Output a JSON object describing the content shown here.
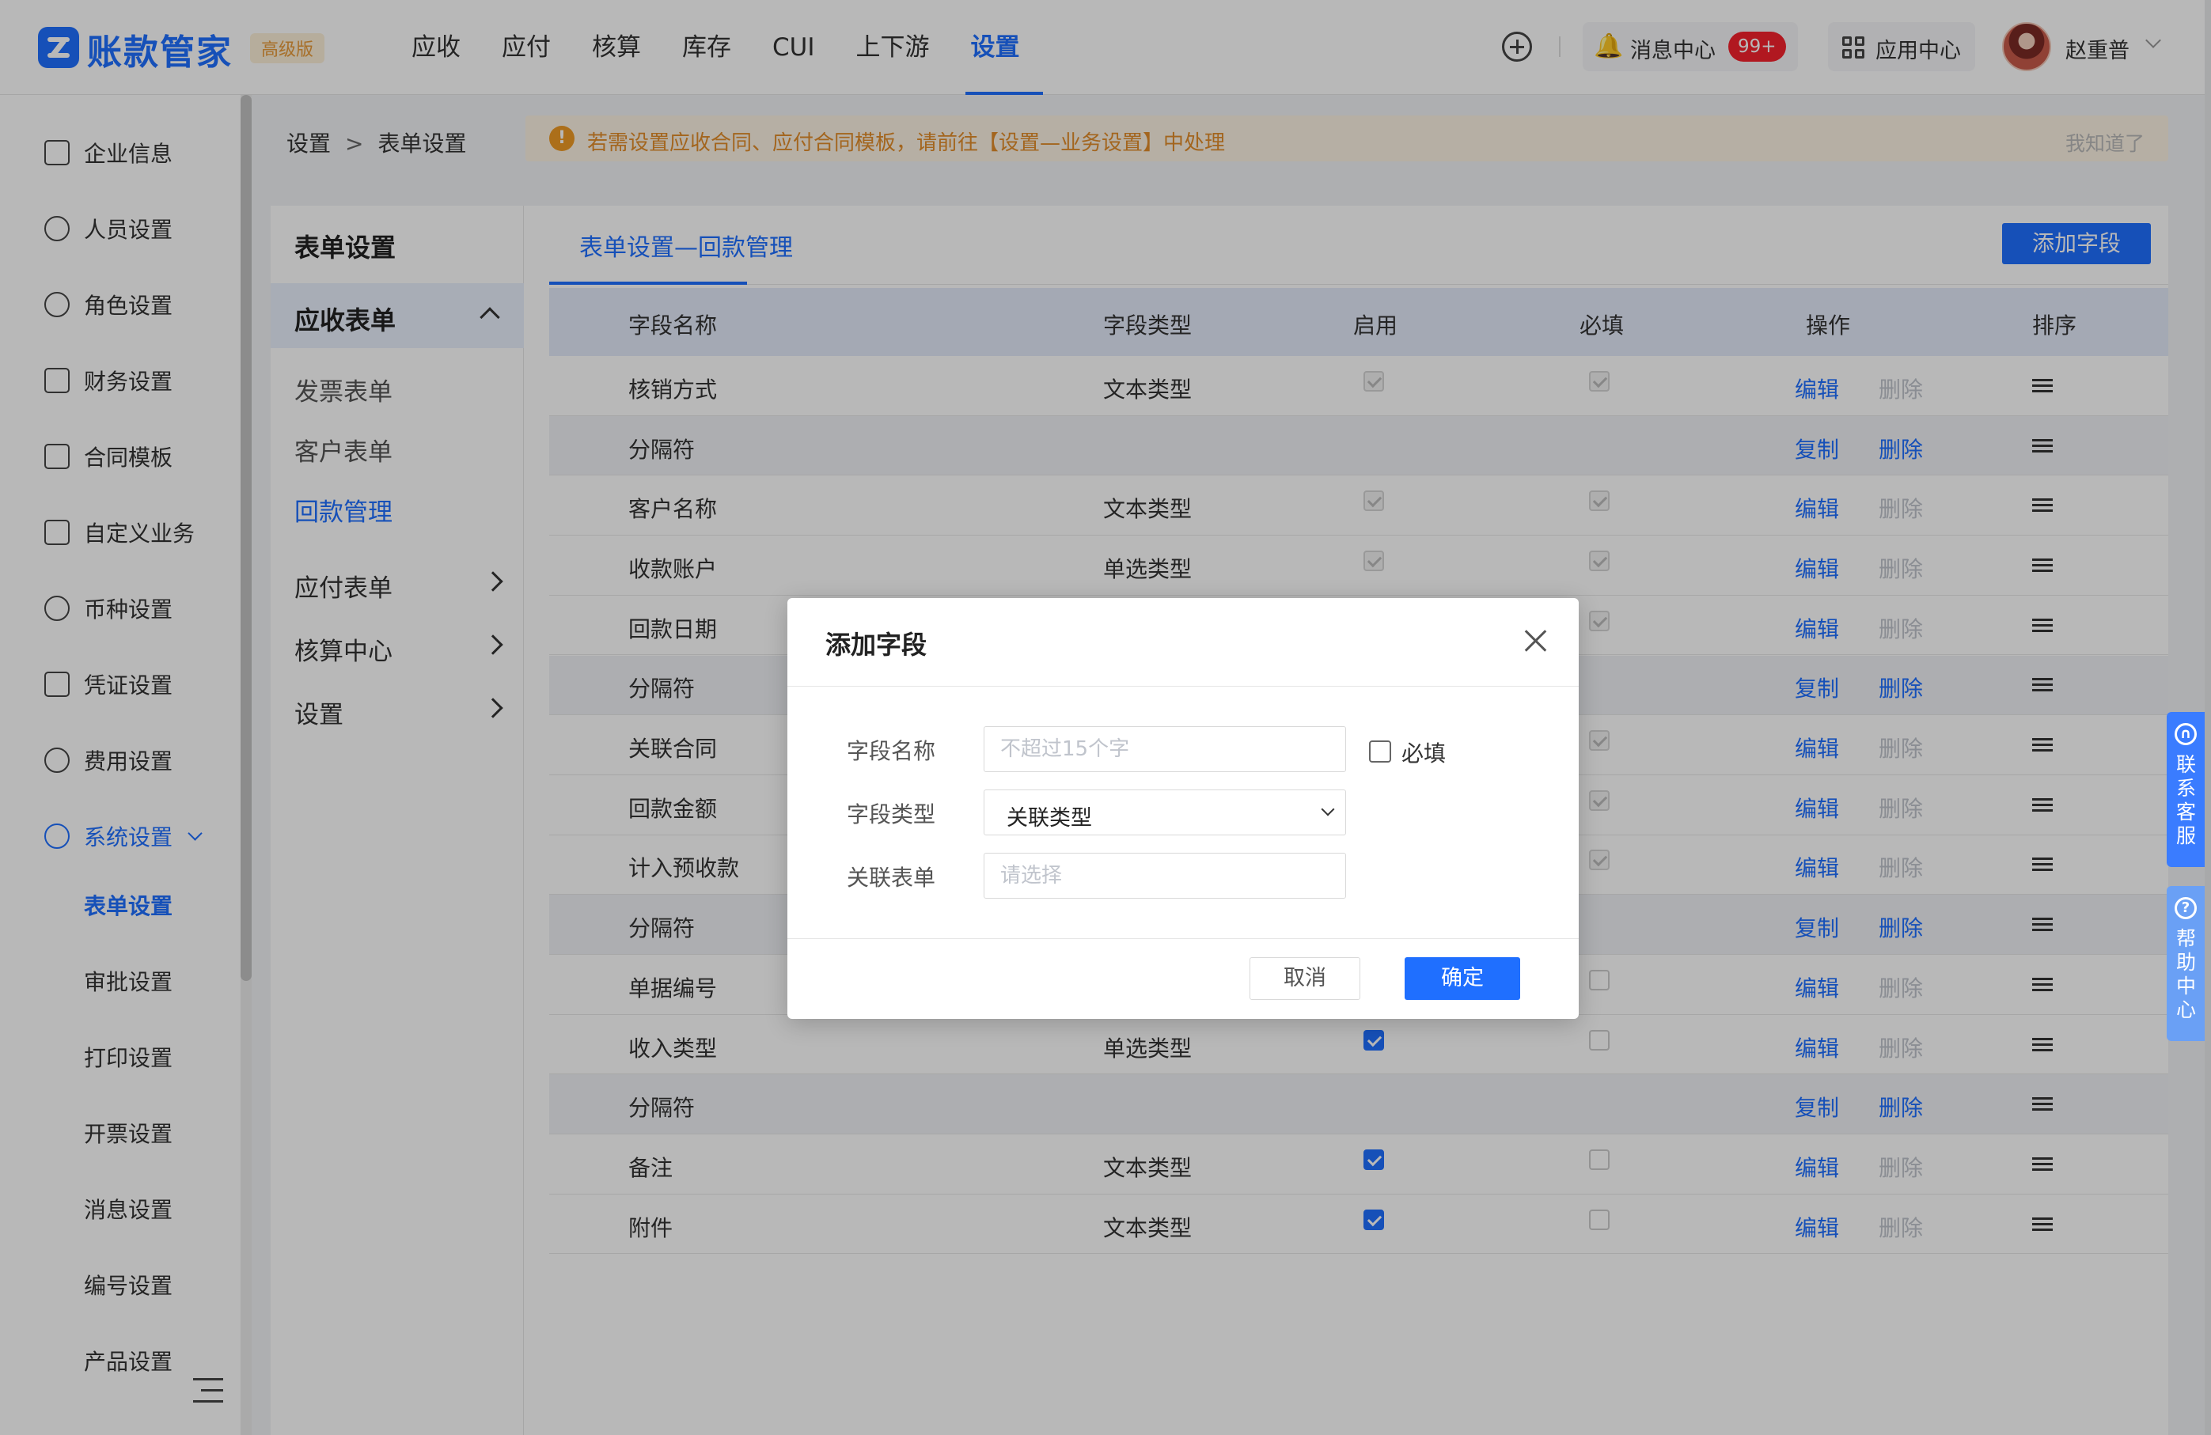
{
  "app": {
    "name": "账款管家",
    "edition": "高级版"
  },
  "nav": [
    "应收",
    "应付",
    "核算",
    "库存",
    "CUI",
    "上下游",
    "设置"
  ],
  "header": {
    "message_center": "消息中心",
    "message_count": "99+",
    "app_center": "应用中心",
    "user_name": "赵重普"
  },
  "sidebar": {
    "items": [
      {
        "label": "企业信息",
        "icon": "building-icon"
      },
      {
        "label": "人员设置",
        "icon": "user-icon"
      },
      {
        "label": "角色设置",
        "icon": "role-icon"
      },
      {
        "label": "财务设置",
        "icon": "finance-icon"
      },
      {
        "label": "合同模板",
        "icon": "contract-icon"
      },
      {
        "label": "自定义业务",
        "icon": "custom-business-icon"
      },
      {
        "label": "币种设置",
        "icon": "currency-icon"
      },
      {
        "label": "凭证设置",
        "icon": "voucher-icon"
      },
      {
        "label": "费用设置",
        "icon": "expense-icon"
      },
      {
        "label": "系统设置",
        "icon": "system-settings-icon"
      }
    ],
    "subitems": [
      "表单设置",
      "审批设置",
      "打印设置",
      "开票设置",
      "消息设置",
      "编号设置",
      "产品设置"
    ]
  },
  "breadcrumb": {
    "root": "设置",
    "separator": ">",
    "current": "表单设置"
  },
  "notice": {
    "text": "若需设置应收合同、应付合同模板，请前往【设置—业务设置】中处理",
    "dismiss": "我知道了"
  },
  "subnav": {
    "title": "表单设置",
    "group": "应收表单",
    "subitems": [
      "发票表单",
      "客户表单",
      "回款管理"
    ],
    "rows": [
      "应付表单",
      "核算中心",
      "设置"
    ]
  },
  "tab": {
    "title": "表单设置—回款管理",
    "add_button": "添加字段"
  },
  "table": {
    "headers": [
      "字段名称",
      "字段类型",
      "启用",
      "必填",
      "操作",
      "排序"
    ],
    "rows": [
      {
        "name": "核销方式",
        "type": "文本类型",
        "sep": false,
        "enabled": "disabled-checked",
        "required": "disabled-checked",
        "a1": "编辑",
        "a2": "删除"
      },
      {
        "name": "分隔符",
        "type": "",
        "sep": true,
        "a1": "复制",
        "a2": "删除"
      },
      {
        "name": "客户名称",
        "type": "文本类型",
        "sep": false,
        "enabled": "disabled-checked",
        "required": "disabled-checked",
        "a1": "编辑",
        "a2": "删除"
      },
      {
        "name": "收款账户",
        "type": "单选类型",
        "sep": false,
        "enabled": "disabled-checked",
        "required": "disabled-checked",
        "a1": "编辑",
        "a2": "删除"
      },
      {
        "name": "回款日期",
        "type": "",
        "sep": false,
        "enabled": "disabled-checked",
        "required": "disabled-checked",
        "a1": "编辑",
        "a2": "删除"
      },
      {
        "name": "分隔符",
        "type": "",
        "sep": true,
        "a1": "复制",
        "a2": "删除"
      },
      {
        "name": "关联合同",
        "type": "",
        "sep": false,
        "enabled": "disabled-checked",
        "required": "disabled-checked",
        "a1": "编辑",
        "a2": "删除"
      },
      {
        "name": "回款金额",
        "type": "",
        "sep": false,
        "enabled": "disabled-checked",
        "required": "disabled-checked",
        "a1": "编辑",
        "a2": "删除"
      },
      {
        "name": "计入预收款",
        "type": "",
        "sep": false,
        "enabled": "disabled-checked",
        "required": "disabled-checked",
        "a1": "编辑",
        "a2": "删除"
      },
      {
        "name": "分隔符",
        "type": "",
        "sep": true,
        "a1": "复制",
        "a2": "删除"
      },
      {
        "name": "单据编号",
        "type": "",
        "sep": false,
        "enabled": "checked",
        "required": "unchecked",
        "a1": "编辑",
        "a2": "删除"
      },
      {
        "name": "收入类型",
        "type": "单选类型",
        "sep": false,
        "enabled": "checked",
        "required": "unchecked",
        "a1": "编辑",
        "a2": "删除"
      },
      {
        "name": "分隔符",
        "type": "",
        "sep": true,
        "a1": "复制",
        "a2": "删除"
      },
      {
        "name": "备注",
        "type": "文本类型",
        "sep": false,
        "enabled": "checked",
        "required": "unchecked",
        "a1": "编辑",
        "a2": "删除"
      },
      {
        "name": "附件",
        "type": "文本类型",
        "sep": false,
        "enabled": "checked",
        "required": "unchecked",
        "a1": "编辑",
        "a2": "删除"
      }
    ]
  },
  "modal": {
    "title": "添加字段",
    "field_name_label": "字段名称",
    "field_name_placeholder": "不超过15个字",
    "required_label": "必填",
    "field_type_label": "字段类型",
    "field_type_value": "关联类型",
    "related_form_label": "关联表单",
    "related_form_placeholder": "请选择",
    "cancel": "取消",
    "ok": "确定"
  },
  "side_tabs": {
    "contact": "联系客服",
    "help": "帮助中心"
  },
  "colors": {
    "primary": "#1f6fff",
    "notice_text": "#e28d2a",
    "badge": "#f5222d"
  }
}
